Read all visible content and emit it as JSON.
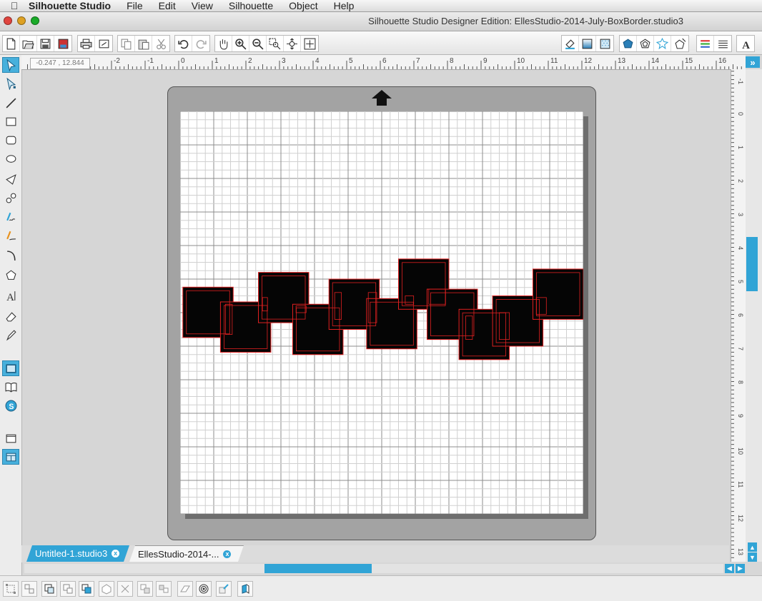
{
  "menubar": {
    "app_name": "Silhouette Studio",
    "menus": [
      "File",
      "Edit",
      "View",
      "Silhouette",
      "Object",
      "Help"
    ]
  },
  "window": {
    "title": "Silhouette Studio Designer Edition: EllesStudio-2014-July-BoxBorder.studio3",
    "traffic_lights": [
      "#e0443e",
      "#dea123",
      "#1aab29"
    ]
  },
  "toolbar": {
    "left_icons": [
      "new-file-icon",
      "open-file-icon",
      "save-icon",
      "save-to-library-icon",
      "print-icon",
      "print-cut-icon",
      "copy-icon",
      "paste-icon",
      "cut-icon",
      "undo-icon",
      "redo-icon",
      "pan-hand-icon",
      "zoom-in-icon",
      "zoom-out-icon",
      "zoom-selection-icon",
      "drag-zoom-icon",
      "fit-to-page-icon"
    ],
    "right_icons": [
      "fill-color-icon",
      "gradient-fill-icon",
      "pattern-fill-icon",
      "line-color-icon",
      "line-style-icon",
      "shadow-icon",
      "offset-icon",
      "trace-icon",
      "align-icon",
      "transform-icon",
      "text-style-icon"
    ]
  },
  "lefttools": {
    "icons": [
      "select-icon",
      "point-edit-icon",
      "line-icon",
      "rectangle-icon",
      "rounded-rectangle-icon",
      "ellipse-icon",
      "polygon-icon",
      "curve-icon",
      "freehand-icon",
      "smooth-freehand-icon",
      "arc-icon",
      "regular-polygon-icon",
      "text-icon",
      "eraser-icon",
      "knife-icon",
      "page-setup-icon",
      "library-icon",
      "store-icon",
      "design-area-icon",
      "cut-settings-icon"
    ]
  },
  "ruler": {
    "coords": "-0.247 , 12.844",
    "top_numbers": [
      "-2",
      "-1",
      "0",
      "1",
      "2",
      "3",
      "4",
      "5",
      "6",
      "7",
      "8",
      "9",
      "10",
      "11",
      "12",
      "13",
      "14",
      "15",
      "16"
    ],
    "side_numbers": [
      "-1",
      "0",
      "1",
      "2",
      "3",
      "4",
      "5",
      "6",
      "7",
      "8",
      "9",
      "10",
      "11",
      "12",
      "13"
    ]
  },
  "tabs": [
    {
      "label": "Untitled-1.studio3",
      "active": false
    },
    {
      "label": "EllesStudio-2014-...",
      "active": true
    }
  ],
  "tab_close": "x",
  "expand_glyph": "»",
  "scroll_glyphs": {
    "left": "◀",
    "right": "▶",
    "up": "▲",
    "down": "▼"
  },
  "bottombar": {
    "icons": [
      "group-icon",
      "ungroup-icon",
      "compound-path-icon",
      "release-compound-icon",
      "bring-to-front-icon",
      "weld-icon",
      "crop-icon",
      "duplicate-icon",
      "mirror-icon",
      "transform-icon",
      "offset-icon",
      "trace-icon",
      "cut-icon",
      "replicate-icon"
    ]
  },
  "colors": {
    "accent": "#31a4d6",
    "cut_line": "#e02020",
    "shape_fill": "#050505"
  }
}
